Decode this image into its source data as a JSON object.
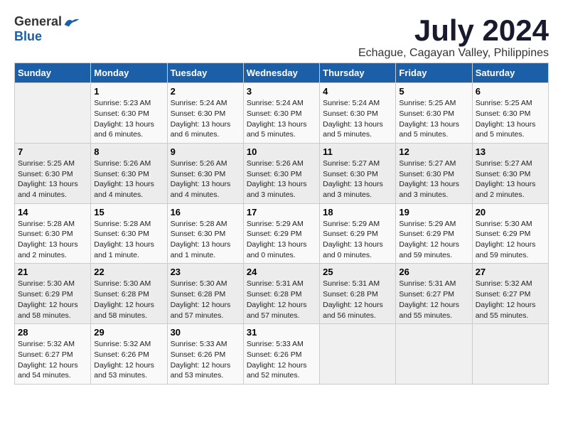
{
  "logo": {
    "general": "General",
    "blue": "Blue"
  },
  "title": "July 2024",
  "subtitle": "Echague, Cagayan Valley, Philippines",
  "headers": [
    "Sunday",
    "Monday",
    "Tuesday",
    "Wednesday",
    "Thursday",
    "Friday",
    "Saturday"
  ],
  "weeks": [
    [
      {
        "day": "",
        "info": ""
      },
      {
        "day": "1",
        "info": "Sunrise: 5:23 AM\nSunset: 6:30 PM\nDaylight: 13 hours\nand 6 minutes."
      },
      {
        "day": "2",
        "info": "Sunrise: 5:24 AM\nSunset: 6:30 PM\nDaylight: 13 hours\nand 6 minutes."
      },
      {
        "day": "3",
        "info": "Sunrise: 5:24 AM\nSunset: 6:30 PM\nDaylight: 13 hours\nand 5 minutes."
      },
      {
        "day": "4",
        "info": "Sunrise: 5:24 AM\nSunset: 6:30 PM\nDaylight: 13 hours\nand 5 minutes."
      },
      {
        "day": "5",
        "info": "Sunrise: 5:25 AM\nSunset: 6:30 PM\nDaylight: 13 hours\nand 5 minutes."
      },
      {
        "day": "6",
        "info": "Sunrise: 5:25 AM\nSunset: 6:30 PM\nDaylight: 13 hours\nand 5 minutes."
      }
    ],
    [
      {
        "day": "7",
        "info": "Sunrise: 5:25 AM\nSunset: 6:30 PM\nDaylight: 13 hours\nand 4 minutes."
      },
      {
        "day": "8",
        "info": "Sunrise: 5:26 AM\nSunset: 6:30 PM\nDaylight: 13 hours\nand 4 minutes."
      },
      {
        "day": "9",
        "info": "Sunrise: 5:26 AM\nSunset: 6:30 PM\nDaylight: 13 hours\nand 4 minutes."
      },
      {
        "day": "10",
        "info": "Sunrise: 5:26 AM\nSunset: 6:30 PM\nDaylight: 13 hours\nand 3 minutes."
      },
      {
        "day": "11",
        "info": "Sunrise: 5:27 AM\nSunset: 6:30 PM\nDaylight: 13 hours\nand 3 minutes."
      },
      {
        "day": "12",
        "info": "Sunrise: 5:27 AM\nSunset: 6:30 PM\nDaylight: 13 hours\nand 3 minutes."
      },
      {
        "day": "13",
        "info": "Sunrise: 5:27 AM\nSunset: 6:30 PM\nDaylight: 13 hours\nand 2 minutes."
      }
    ],
    [
      {
        "day": "14",
        "info": "Sunrise: 5:28 AM\nSunset: 6:30 PM\nDaylight: 13 hours\nand 2 minutes."
      },
      {
        "day": "15",
        "info": "Sunrise: 5:28 AM\nSunset: 6:30 PM\nDaylight: 13 hours\nand 1 minute."
      },
      {
        "day": "16",
        "info": "Sunrise: 5:28 AM\nSunset: 6:30 PM\nDaylight: 13 hours\nand 1 minute."
      },
      {
        "day": "17",
        "info": "Sunrise: 5:29 AM\nSunset: 6:29 PM\nDaylight: 13 hours\nand 0 minutes."
      },
      {
        "day": "18",
        "info": "Sunrise: 5:29 AM\nSunset: 6:29 PM\nDaylight: 13 hours\nand 0 minutes."
      },
      {
        "day": "19",
        "info": "Sunrise: 5:29 AM\nSunset: 6:29 PM\nDaylight: 12 hours\nand 59 minutes."
      },
      {
        "day": "20",
        "info": "Sunrise: 5:30 AM\nSunset: 6:29 PM\nDaylight: 12 hours\nand 59 minutes."
      }
    ],
    [
      {
        "day": "21",
        "info": "Sunrise: 5:30 AM\nSunset: 6:29 PM\nDaylight: 12 hours\nand 58 minutes."
      },
      {
        "day": "22",
        "info": "Sunrise: 5:30 AM\nSunset: 6:28 PM\nDaylight: 12 hours\nand 58 minutes."
      },
      {
        "day": "23",
        "info": "Sunrise: 5:30 AM\nSunset: 6:28 PM\nDaylight: 12 hours\nand 57 minutes."
      },
      {
        "day": "24",
        "info": "Sunrise: 5:31 AM\nSunset: 6:28 PM\nDaylight: 12 hours\nand 57 minutes."
      },
      {
        "day": "25",
        "info": "Sunrise: 5:31 AM\nSunset: 6:28 PM\nDaylight: 12 hours\nand 56 minutes."
      },
      {
        "day": "26",
        "info": "Sunrise: 5:31 AM\nSunset: 6:27 PM\nDaylight: 12 hours\nand 55 minutes."
      },
      {
        "day": "27",
        "info": "Sunrise: 5:32 AM\nSunset: 6:27 PM\nDaylight: 12 hours\nand 55 minutes."
      }
    ],
    [
      {
        "day": "28",
        "info": "Sunrise: 5:32 AM\nSunset: 6:27 PM\nDaylight: 12 hours\nand 54 minutes."
      },
      {
        "day": "29",
        "info": "Sunrise: 5:32 AM\nSunset: 6:26 PM\nDaylight: 12 hours\nand 53 minutes."
      },
      {
        "day": "30",
        "info": "Sunrise: 5:33 AM\nSunset: 6:26 PM\nDaylight: 12 hours\nand 53 minutes."
      },
      {
        "day": "31",
        "info": "Sunrise: 5:33 AM\nSunset: 6:26 PM\nDaylight: 12 hours\nand 52 minutes."
      },
      {
        "day": "",
        "info": ""
      },
      {
        "day": "",
        "info": ""
      },
      {
        "day": "",
        "info": ""
      }
    ]
  ]
}
